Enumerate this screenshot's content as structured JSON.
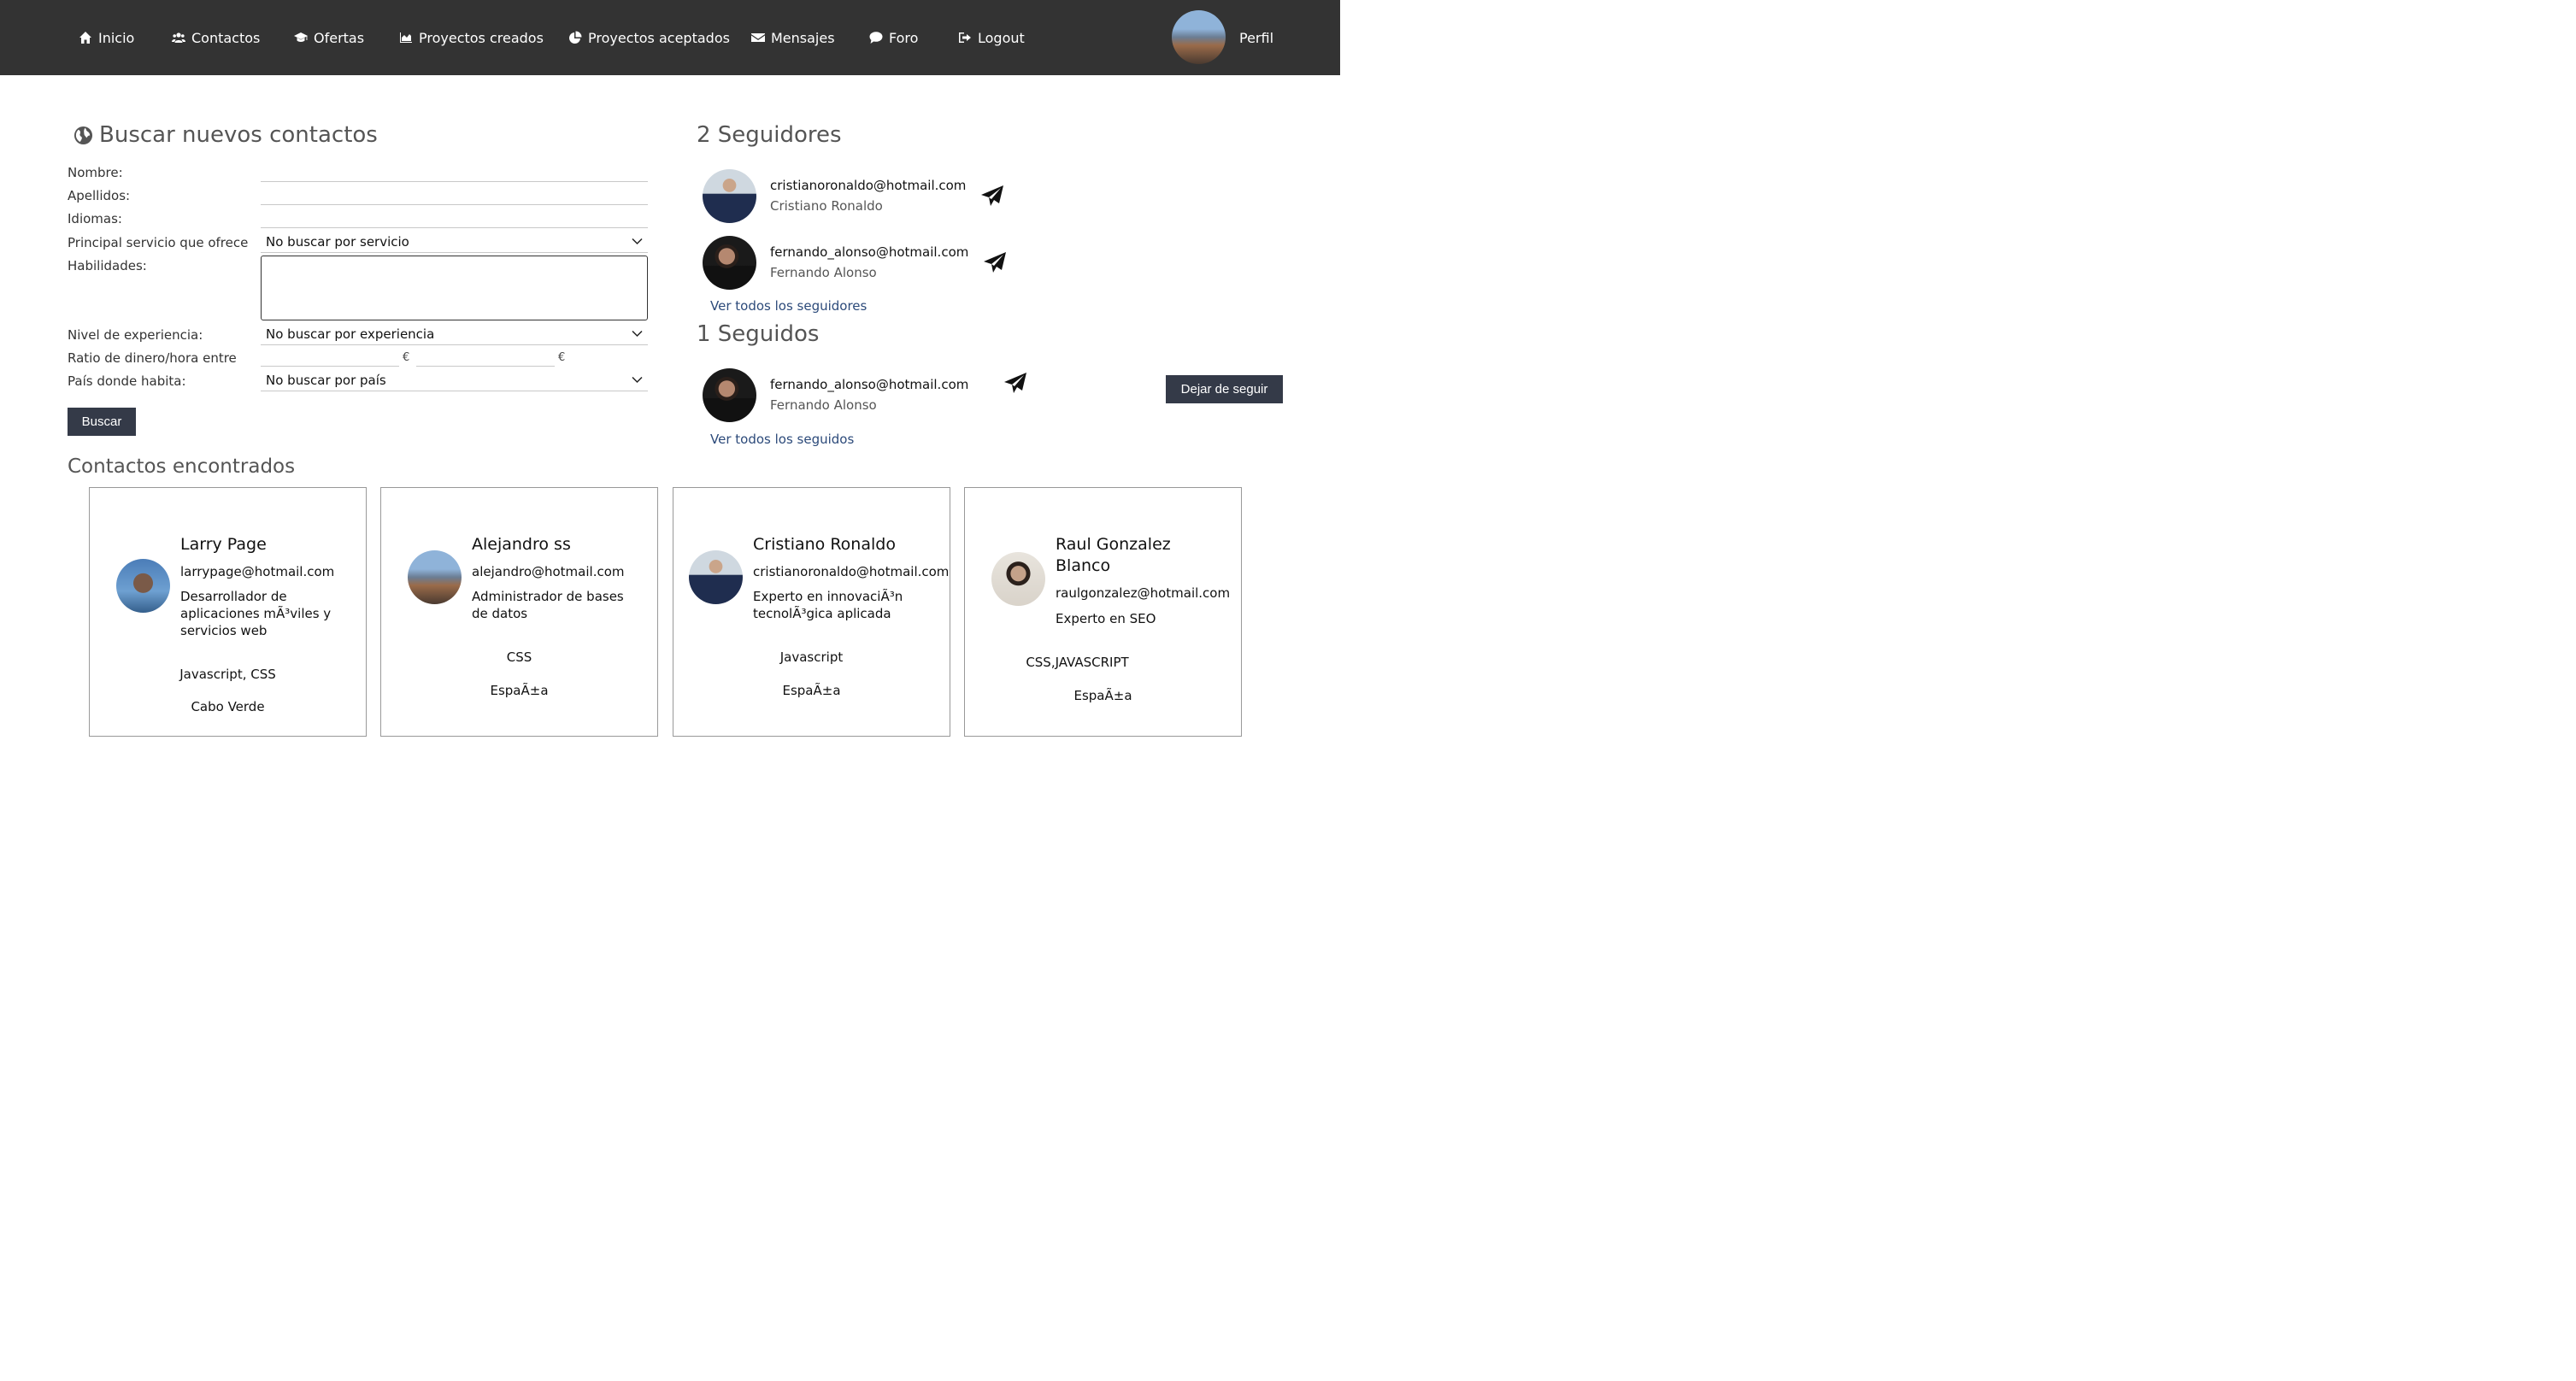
{
  "nav": {
    "items": [
      {
        "label": "Inicio",
        "icon": "home-icon"
      },
      {
        "label": "Contactos",
        "icon": "users-icon"
      },
      {
        "label": "Ofertas",
        "icon": "graduation-cap-icon"
      },
      {
        "label": "Proyectos creados",
        "icon": "area-chart-icon"
      },
      {
        "label": "Proyectos aceptados",
        "icon": "pie-chart-icon"
      },
      {
        "label": "Mensajes",
        "icon": "envelope-icon"
      },
      {
        "label": "Foro",
        "icon": "comment-icon"
      },
      {
        "label": "Logout",
        "icon": "sign-out-icon"
      }
    ],
    "profile_label": "Perfil"
  },
  "search": {
    "title": "Buscar nuevos contactos",
    "labels": {
      "nombre": "Nombre:",
      "apellidos": "Apellidos:",
      "idiomas": "Idiomas:",
      "servicio": "Principal servicio que ofrece",
      "habilidades": "Habilidades:",
      "experiencia": "Nivel de experiencia:",
      "ratio": "Ratio de dinero/hora entre",
      "pais": "País donde habita:"
    },
    "values": {
      "nombre": "",
      "apellidos": "",
      "idiomas": "",
      "servicio": "No buscar por servicio",
      "habilidades": "",
      "experiencia": "No buscar por experiencia",
      "ratio_min": "",
      "ratio_max": "",
      "pais": "No buscar por país"
    },
    "currency": "€",
    "button": "Buscar"
  },
  "followers": {
    "title": "2 Seguidores",
    "items": [
      {
        "email": "cristianoronaldo@hotmail.com",
        "name": "Cristiano Ronaldo"
      },
      {
        "email": "fernando_alonso@hotmail.com",
        "name": "Fernando Alonso"
      }
    ],
    "link": "Ver todos los seguidores"
  },
  "following": {
    "title": "1 Seguidos",
    "items": [
      {
        "email": "fernando_alonso@hotmail.com",
        "name": "Fernando Alonso",
        "action": "Dejar de seguir"
      }
    ],
    "link": "Ver todos los seguidos"
  },
  "results": {
    "title": "Contactos encontrados",
    "cards": [
      {
        "name": "Larry Page",
        "email": "larrypage@hotmail.com",
        "desc": "Desarrollador de aplicaciones mÃ³viles y servicios web",
        "skills": "Javascript, CSS",
        "country": "Cabo Verde"
      },
      {
        "name": "Alejandro ss",
        "email": "alejandro@hotmail.com",
        "desc": "Administrador de bases de datos",
        "skills": "CSS",
        "country": "EspaÃ±a"
      },
      {
        "name": "Cristiano Ronaldo",
        "email": "cristianoronaldo@hotmail.com",
        "desc": "Experto en innovaciÃ³n tecnolÃ³gica aplicada",
        "skills": "Javascript",
        "country": "EspaÃ±a"
      },
      {
        "name": "Raul Gonzalez Blanco",
        "email": "raulgonzalez@hotmail.com",
        "desc": "Experto en SEO",
        "skills": "CSS,JAVASCRIPT",
        "country": "EspaÃ±a"
      }
    ]
  },
  "colors": {
    "navbar": "#333333",
    "button": "#343a48",
    "link": "#2c4a7a"
  }
}
